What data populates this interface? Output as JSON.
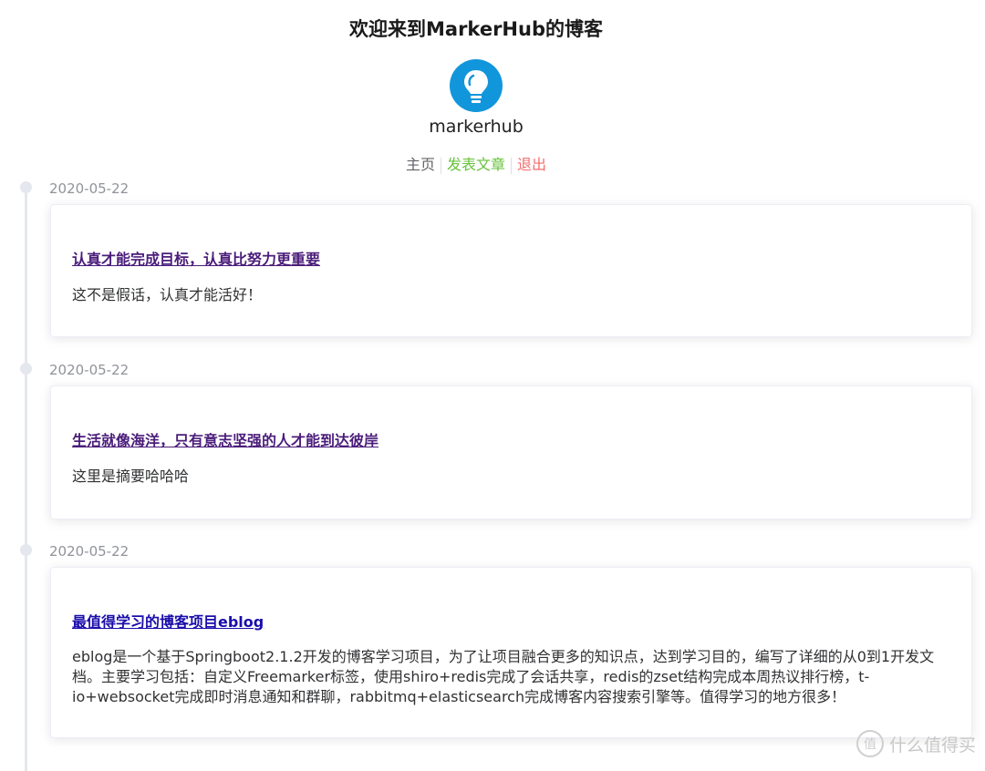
{
  "header": {
    "title": "欢迎来到MarkerHub的博客",
    "username": "markerhub"
  },
  "nav": {
    "home": "主页",
    "post": "发表文章",
    "logout": "退出"
  },
  "colors": {
    "avatar": "#1296db",
    "post_link": "#67c23a",
    "logout_link": "#f56c6c"
  },
  "timeline": [
    {
      "date": "2020-05-22",
      "title": "认真才能完成目标，认真比努力更重要",
      "description": "这不是假话，认真才能活好！"
    },
    {
      "date": "2020-05-22",
      "title": "生活就像海洋，只有意志坚强的人才能到达彼岸",
      "description": "这里是摘要哈哈哈"
    },
    {
      "date": "2020-05-22",
      "title": "最值得学习的博客项目eblog",
      "description": "eblog是一个基于Springboot2.1.2开发的博客学习项目，为了让项目融合更多的知识点，达到学习目的，编写了详细的从0到1开发文档。主要学习包括：自定义Freemarker标签，使用shiro+redis完成了会话共享，redis的zset结构完成本周热议排行榜，t-io+websocket完成即时消息通知和群聊，rabbitmq+elasticsearch完成博客内容搜索引擎等。值得学习的地方很多！"
    }
  ],
  "watermark": {
    "icon_char": "值",
    "text": "什么值得买"
  }
}
